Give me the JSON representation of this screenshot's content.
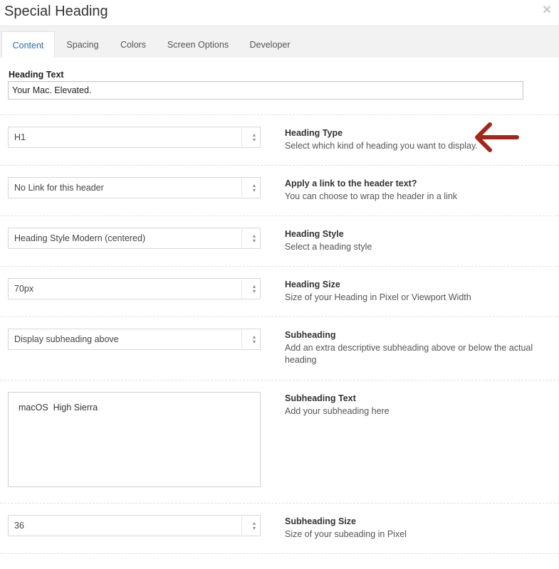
{
  "dialog": {
    "title": "Special Heading",
    "close_icon": "close-icon"
  },
  "tabs": [
    {
      "label": "Content",
      "active": true
    },
    {
      "label": "Spacing",
      "active": false
    },
    {
      "label": "Colors",
      "active": false
    },
    {
      "label": "Screen Options",
      "active": false
    },
    {
      "label": "Developer",
      "active": false
    }
  ],
  "heading_text": {
    "label": "Heading Text",
    "value": "Your Mac. Elevated."
  },
  "options": [
    {
      "value": "H1",
      "title": "Heading Type",
      "desc": "Select which kind of heading you want to display."
    },
    {
      "value": "No Link for this header",
      "title": "Apply a link to the header text?",
      "desc": "You can choose to wrap the header in a link"
    },
    {
      "value": "Heading Style Modern (centered)",
      "title": "Heading Style",
      "desc": "Select a heading style"
    },
    {
      "value": "70px",
      "title": "Heading Size",
      "desc": "Size of your Heading in Pixel or Viewport Width"
    },
    {
      "value": "Display subheading above",
      "title": "Subheading",
      "desc": "Add an extra descriptive subheading above or below the actual heading"
    },
    {
      "value": "36",
      "title": "Subheading Size",
      "desc": "Size of your subeading in Pixel"
    }
  ],
  "subheading_text": {
    "title": "Subheading Text",
    "desc": "Add your subheading here",
    "value": "macOS  High Sierra"
  },
  "colors": {
    "accent": "#2e6da4",
    "annotation_arrow": "#a3261a"
  }
}
